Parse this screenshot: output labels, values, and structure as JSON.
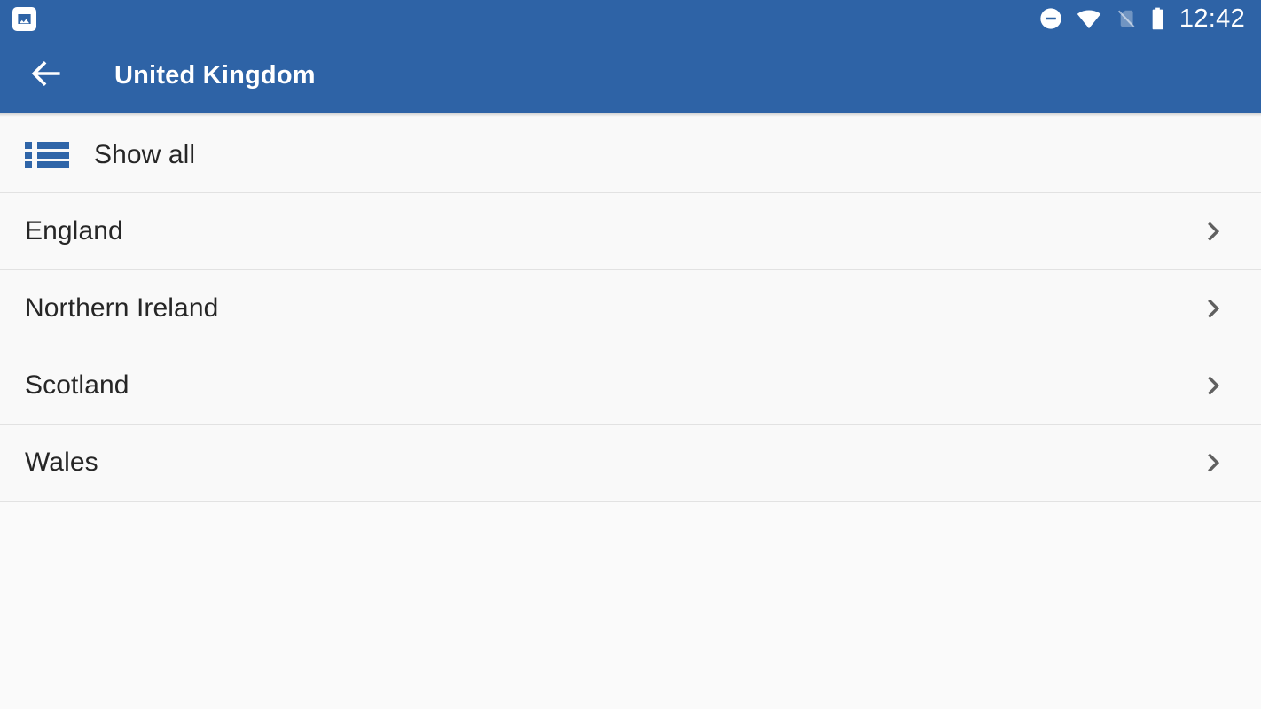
{
  "status_bar": {
    "notification_icon": "image-photo-icon",
    "icons": [
      {
        "name": "do-not-disturb-icon",
        "label": "Do not disturb"
      },
      {
        "name": "wifi-icon",
        "label": "Wi-Fi connected"
      },
      {
        "name": "no-sim-icon",
        "label": "No SIM card"
      },
      {
        "name": "battery-full-icon",
        "label": "Battery full"
      }
    ],
    "time": "12:42"
  },
  "app_bar": {
    "back_icon": "arrow-left-icon",
    "title": "United Kingdom"
  },
  "show_all": {
    "icon": "list-bulleted-icon",
    "label": "Show all"
  },
  "list": {
    "chevron_icon": "chevron-right-icon",
    "items": [
      {
        "label": "England"
      },
      {
        "label": "Northern Ireland"
      },
      {
        "label": "Scotland"
      },
      {
        "label": "Wales"
      }
    ]
  },
  "colors": {
    "app_bar_blue": "#2e63a6",
    "accent_blue": "#2f65a8",
    "row_background": "#f9f9f9",
    "page_background": "#fafafa",
    "divider": "#e2e2e2",
    "text_primary": "#262626",
    "chevron": "#606060"
  }
}
